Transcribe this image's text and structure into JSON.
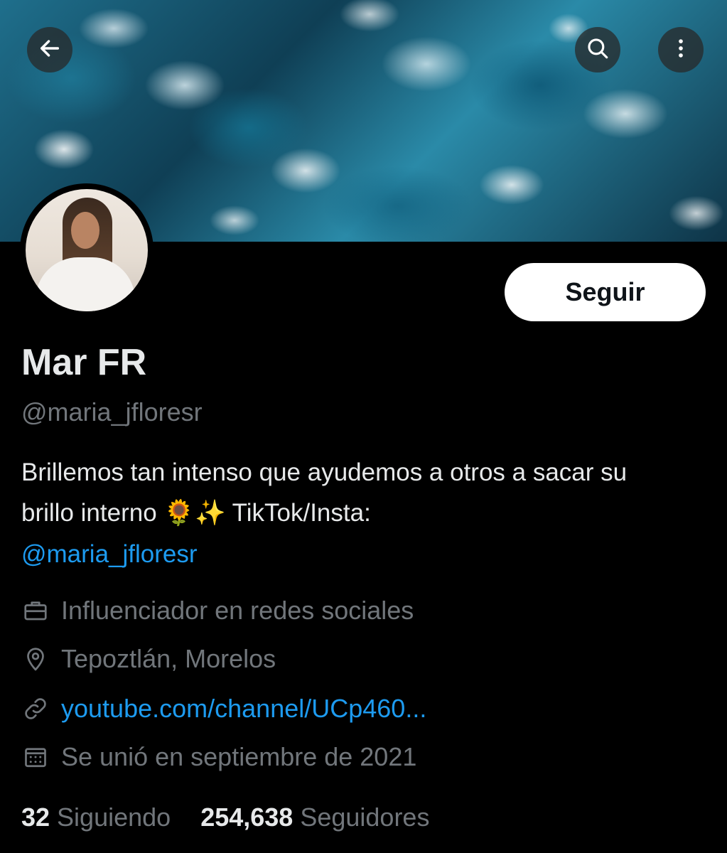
{
  "header": {
    "back_icon": "arrow-left-icon",
    "search_icon": "search-icon",
    "more_icon": "more-vertical-icon"
  },
  "profile": {
    "display_name": "Mar FR",
    "handle": "@maria_jfloresr",
    "follow_label": "Seguir",
    "bio_text": "Brillemos tan intenso que ayudemos a otros a sacar su brillo interno",
    "bio_emoji": "🌻✨",
    "bio_suffix": "TikTok/Insta:",
    "bio_link": "@maria_jfloresr",
    "category": "Influenciador en redes sociales",
    "location": "Tepoztlán, Morelos",
    "website": "youtube.com/channel/UCp460...",
    "joined": "Se unió en septiembre de 2021"
  },
  "stats": {
    "following_count": "32",
    "following_label": "Siguiendo",
    "followers_count": "254,638",
    "followers_label": "Seguidores"
  },
  "colors": {
    "background": "#000000",
    "primary_text": "#e7e9ea",
    "secondary_text": "#71767b",
    "link": "#1d9bf0",
    "follow_button_bg": "#ffffff"
  }
}
